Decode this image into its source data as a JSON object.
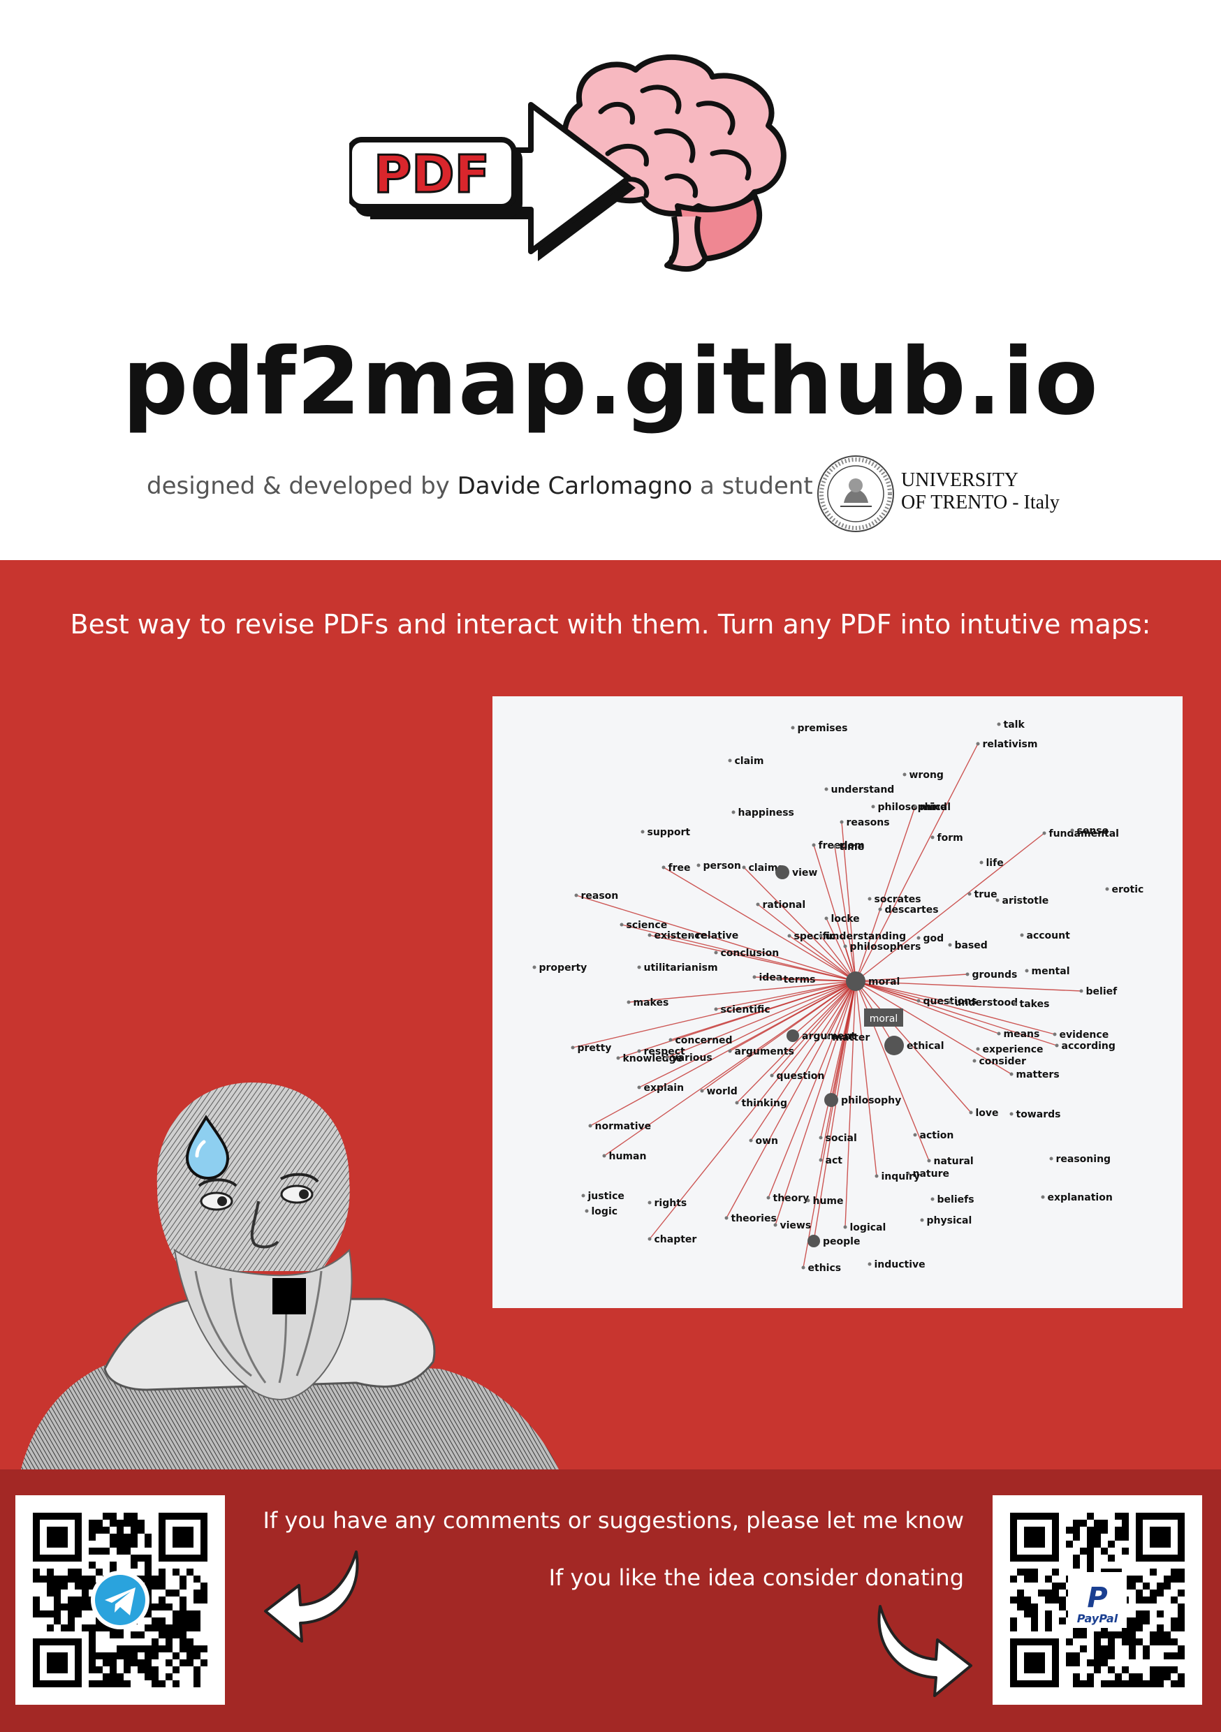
{
  "logo": {
    "pdf_label": "PDF",
    "colors": {
      "pdf_red": "#d9262c",
      "brain_pink": "#f7b8c0",
      "brain_stem": "#ef8792",
      "outline": "#111111"
    }
  },
  "header": {
    "site_title": "pdf2map.github.io",
    "credit_prefix": "designed & developed by",
    "author": "Davide Carlomagno",
    "credit_suffix": "a student of",
    "university_line1": "UNIVERSITY",
    "university_line2": "OF TRENTO - Italy"
  },
  "main": {
    "tagline": "Best way to revise PDFs and interact with them. Turn any PDF into intutive maps:",
    "colors": {
      "band": "#c8352f",
      "footer": "#a32825",
      "edge": "#c22d2a"
    }
  },
  "concept_map": {
    "hub": "moral",
    "tooltip": "moral",
    "nodes": [
      "premises",
      "talk",
      "relativism",
      "claim",
      "wrong",
      "understand",
      "philosophical",
      "mind",
      "happiness",
      "reasons",
      "support",
      "form",
      "fundamental",
      "sense",
      "freedom",
      "time",
      "free",
      "person",
      "claims",
      "view",
      "life",
      "reason",
      "rational",
      "socrates",
      "true",
      "aristotle",
      "erotic",
      "descartes",
      "locke",
      "science",
      "existence",
      "relative",
      "specific",
      "understanding",
      "god",
      "philosophers",
      "based",
      "account",
      "conclusion",
      "property",
      "utilitarianism",
      "idea",
      "terms",
      "grounds",
      "mental",
      "belief",
      "makes",
      "scientific",
      "questions",
      "understood",
      "takes",
      "means",
      "evidence",
      "argument",
      "matter",
      "ethical",
      "according",
      "pretty",
      "concerned",
      "respect",
      "knowledge",
      "various",
      "arguments",
      "experience",
      "consider",
      "question",
      "matters",
      "explain",
      "world",
      "thinking",
      "philosophy",
      "love",
      "towards",
      "normative",
      "own",
      "social",
      "action",
      "human",
      "act",
      "natural",
      "nature",
      "inquiry",
      "reasoning",
      "justice",
      "rights",
      "theory",
      "hume",
      "beliefs",
      "explanation",
      "logic",
      "theories",
      "views",
      "physical",
      "chapter",
      "logical",
      "people",
      "ethics",
      "inductive"
    ]
  },
  "footer": {
    "comments_text": "If you have any comments or suggestions, please let me know",
    "donate_text": "If you like the idea consider donating",
    "telegram_icon": "telegram-icon",
    "paypal_label": "PayPal"
  }
}
